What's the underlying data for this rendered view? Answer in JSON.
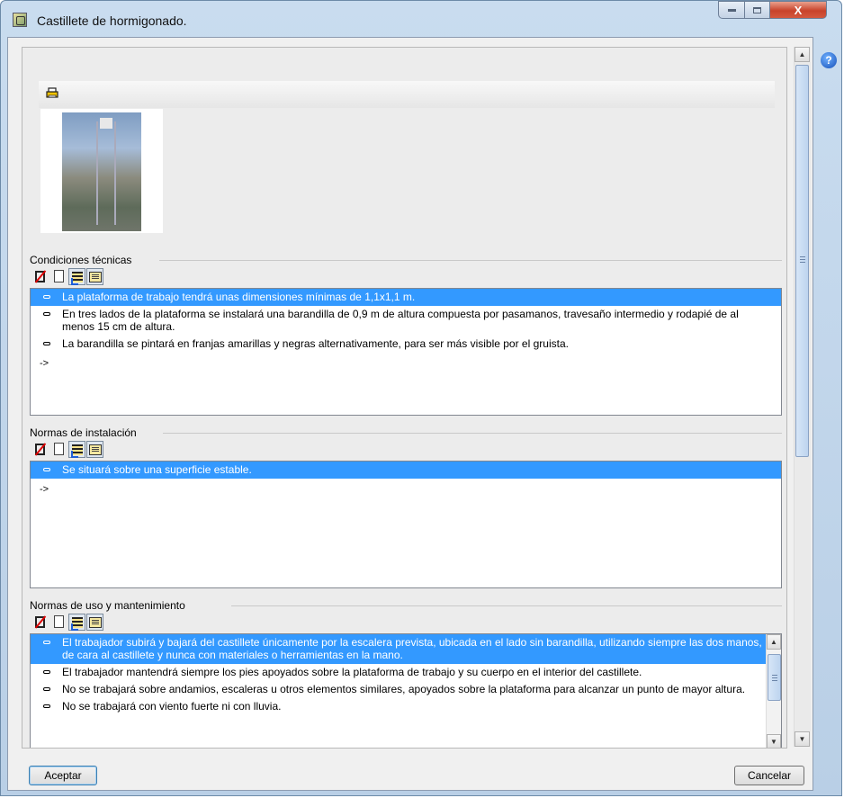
{
  "window": {
    "title": "Castillete de hormigonado."
  },
  "titlebar_buttons": {
    "close_label": "X"
  },
  "help": {
    "label": "?"
  },
  "sections": [
    {
      "label": "Condiciones técnicas",
      "items": [
        "La plataforma de trabajo tendrá unas dimensiones mínimas de 1,1x1,1 m.",
        "En tres lados de la plataforma se instalará una barandilla de 0,9 m de altura compuesta por pasamanos, travesaño intermedio y rodapié de al menos 15 cm de altura.",
        "La barandilla se pintará en franjas amarillas y negras alternativamente, para ser más visible por el gruista."
      ],
      "arrow": "->"
    },
    {
      "label": "Normas de instalación",
      "items": [
        "Se situará sobre una superficie estable."
      ],
      "arrow": "->"
    },
    {
      "label": "Normas de uso y mantenimiento",
      "items": [
        "El trabajador subirá y bajará del castillete únicamente por la escalera prevista, ubicada en el lado sin barandilla, utilizando siempre las dos manos, de cara al castillete y nunca con materiales o herramientas en la mano.",
        "El trabajador mantendrá siempre los pies apoyados sobre la plataforma de trabajo y su cuerpo en el interior del castillete.",
        "No se trabajará sobre andamios, escaleras u otros elementos similares, apoyados sobre la plataforma para alcanzar un punto de mayor altura.",
        "No se trabajará con viento fuerte ni con lluvia."
      ]
    }
  ],
  "buttons": {
    "ok": "Aceptar",
    "cancel": "Cancelar"
  },
  "colors": {
    "selection": "#3399ff",
    "close": "#c8432b"
  }
}
